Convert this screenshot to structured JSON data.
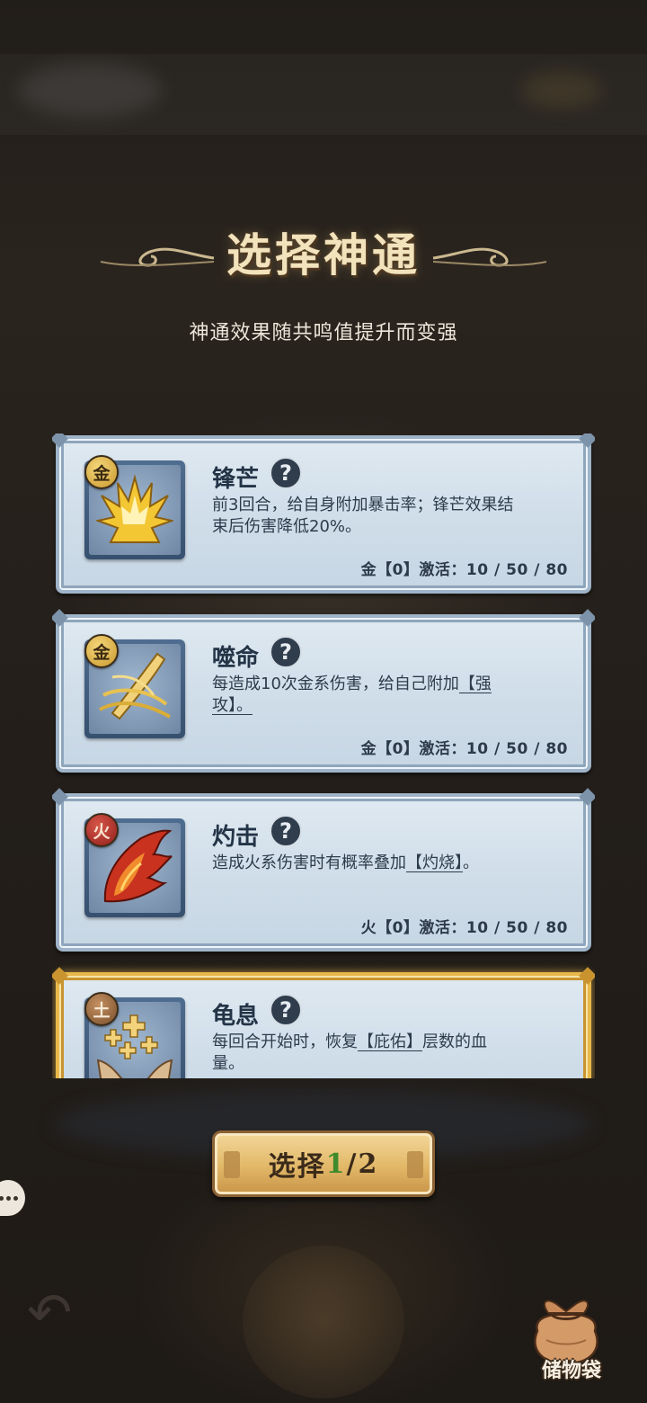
{
  "header": {
    "title": "选择神通",
    "subtitle": "神通效果随共鸣值提升而变强"
  },
  "cards": [
    {
      "name": "锋芒",
      "element": "金",
      "element_color": "#d9aa3a",
      "icon": "golden-flare-icon",
      "description_lines": [
        "前3回合，给自身附加暴击率；锋芒效果结",
        "束后伤害降低20%。"
      ],
      "activation": "金【0】激活：10 / 50 / 80",
      "selected": false
    },
    {
      "name": "噬命",
      "element": "金",
      "element_color": "#d9aa3a",
      "icon": "golden-blade-icon",
      "description_lines": [
        "每造成10次金系伤害，给自己附加",
        "攻】。"
      ],
      "description_tag": "【强",
      "activation": "金【0】激活：10 / 50 / 80",
      "selected": false
    },
    {
      "name": "灼击",
      "element": "火",
      "element_color": "#b8342a",
      "icon": "fire-wing-icon",
      "description_lines": [
        "造成火系伤害时有概率叠加",
        "。"
      ],
      "description_tag": "【灼烧】",
      "activation": "火【0】激活：10 / 50 / 80",
      "selected": false
    },
    {
      "name": "龟息",
      "element": "土",
      "element_color": "#9c6a3e",
      "icon": "healing-hands-icon",
      "description_lines": [
        "每回合开始时，恢复",
        "层数的血",
        "量。"
      ],
      "description_tag": "【庇佑】",
      "selected": true
    }
  ],
  "select_button": {
    "label": "选择",
    "count": "1",
    "total": "/2"
  },
  "storage": {
    "label": "储物袋"
  },
  "colors": {
    "accent_gold": "#e8b84a",
    "card_bg": "#d4e1ec",
    "count_green": "#3e8a2c"
  }
}
